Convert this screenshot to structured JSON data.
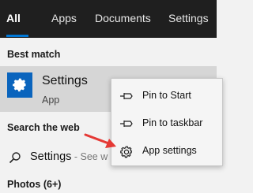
{
  "tabs": [
    {
      "label": "All",
      "active": true
    },
    {
      "label": "Apps"
    },
    {
      "label": "Documents"
    },
    {
      "label": "Settings"
    }
  ],
  "best_match": {
    "heading": "Best match",
    "title": "Settings",
    "subtitle": "App",
    "icon": "gear-icon"
  },
  "search_web": {
    "heading": "Search the web",
    "query": "Settings",
    "suffix": " - See w",
    "icon": "search-icon"
  },
  "photos": {
    "heading": "Photos (6+)"
  },
  "context_menu": {
    "items": [
      {
        "label": "Pin to Start",
        "icon": "pin-icon"
      },
      {
        "label": "Pin to taskbar",
        "icon": "pin-icon"
      },
      {
        "label": "App settings",
        "icon": "gear-icon"
      }
    ]
  },
  "colors": {
    "topbar": "#1f1f1f",
    "accent": "#0078d7",
    "app_tile": "#0a64bd",
    "annotation_arrow": "#e53935"
  }
}
